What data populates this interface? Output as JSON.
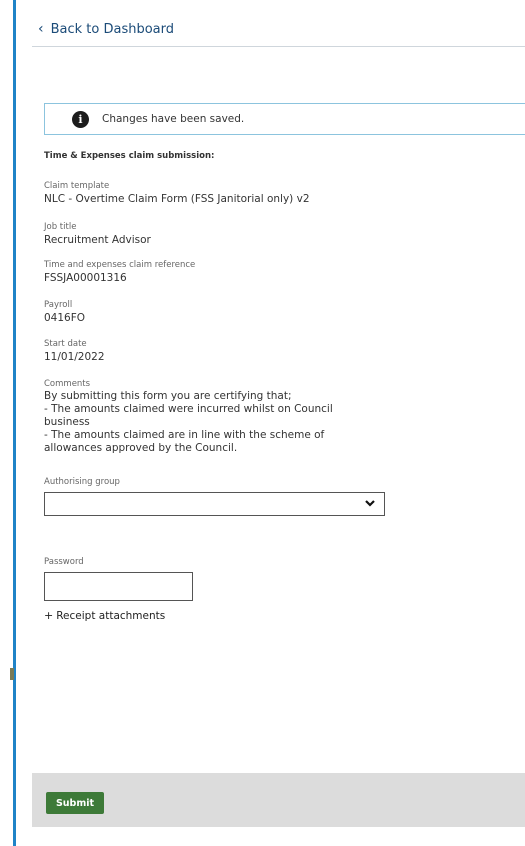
{
  "nav": {
    "back_label": "Back to Dashboard",
    "back_icon": "chevron-left-icon"
  },
  "alert": {
    "icon": "info-icon",
    "icon_glyph": "i",
    "message": "Changes have been saved."
  },
  "form": {
    "section_title": "Time & Expenses claim submission:",
    "claim_template": {
      "label": "Claim template",
      "value": "NLC - Overtime Claim Form (FSS Janitorial only) v2"
    },
    "job_title": {
      "label": "Job title",
      "value": "Recruitment Advisor"
    },
    "claim_reference": {
      "label": "Time and expenses claim reference",
      "value": "FSSJA00001316"
    },
    "payroll": {
      "label": "Payroll",
      "value": "0416FO"
    },
    "start_date": {
      "label": "Start date",
      "value": "11/01/2022"
    },
    "comments": {
      "label": "Comments",
      "lines": [
        "By submitting this form you are certifying that;",
        "- The amounts claimed were incurred whilst on Council business",
        "- The amounts claimed are in line with the scheme of allowances approved by the Council."
      ]
    },
    "authorising_group": {
      "label": "Authorising group",
      "selected": ""
    },
    "password": {
      "label": "Password",
      "value": ""
    },
    "receipt_attachments": {
      "plus": "+",
      "label": "Receipt attachments"
    }
  },
  "footer": {
    "submit_label": "Submit"
  },
  "colors": {
    "accent_blue": "#1f83c7",
    "link": "#1b4b78",
    "alert_border": "#8cc4de",
    "submit_green": "#3d7a38",
    "footer_bg": "#dcdcdc"
  }
}
